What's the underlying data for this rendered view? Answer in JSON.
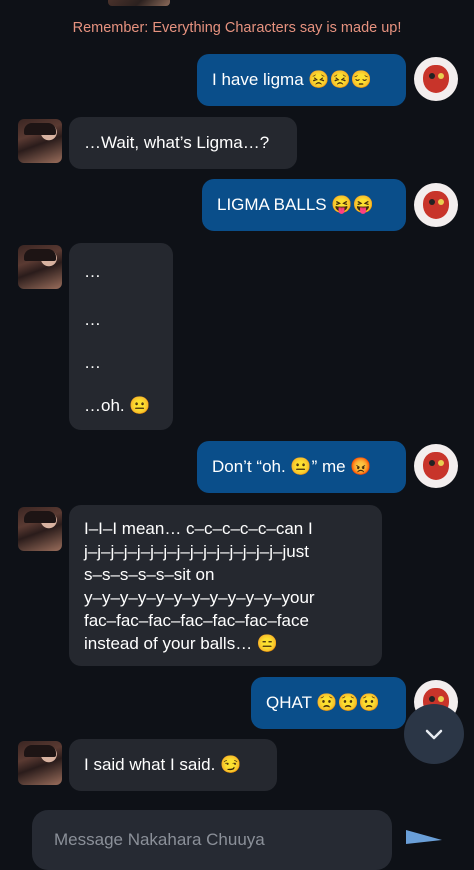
{
  "disclaimer": "Remember: Everything Characters say is made up!",
  "messages": [
    {
      "from": "user",
      "text": "I have ligma 😣😣😔"
    },
    {
      "from": "character",
      "text": "…Wait, what’s Ligma…?"
    },
    {
      "from": "user",
      "text": "LIGMA BALLS 😝😝"
    },
    {
      "from": "character",
      "lines": [
        "…",
        "…",
        "…",
        "…oh. 😐"
      ]
    },
    {
      "from": "user",
      "text": "Don’t “oh. 😐” me 😡"
    },
    {
      "from": "character",
      "lines": [
        "I–I–I mean… c–c–c–c–c–can I",
        "j–j–j–j–j–j–j–j–j–j–j–j–j–j–j–just",
        "s–s–s–s–s–sit on",
        "y–y–y–y–y–y–y–y–y–y–y–your",
        "fac–fac–fac–fac–fac–fac–face",
        "instead of your balls… 😑"
      ]
    },
    {
      "from": "user",
      "text": "QHAT 😟😟😟"
    },
    {
      "from": "character",
      "text": "I said what I said. 😏"
    }
  ],
  "composer": {
    "placeholder": "Message Nakahara Chuuya"
  },
  "icons": {
    "scroll": "chevron-down-icon",
    "send": "send-icon"
  },
  "colors": {
    "user_bubble": "#0a4e8a",
    "char_bubble": "#25282f",
    "disclaimer": "#e6927f",
    "background": "#0e1117"
  }
}
